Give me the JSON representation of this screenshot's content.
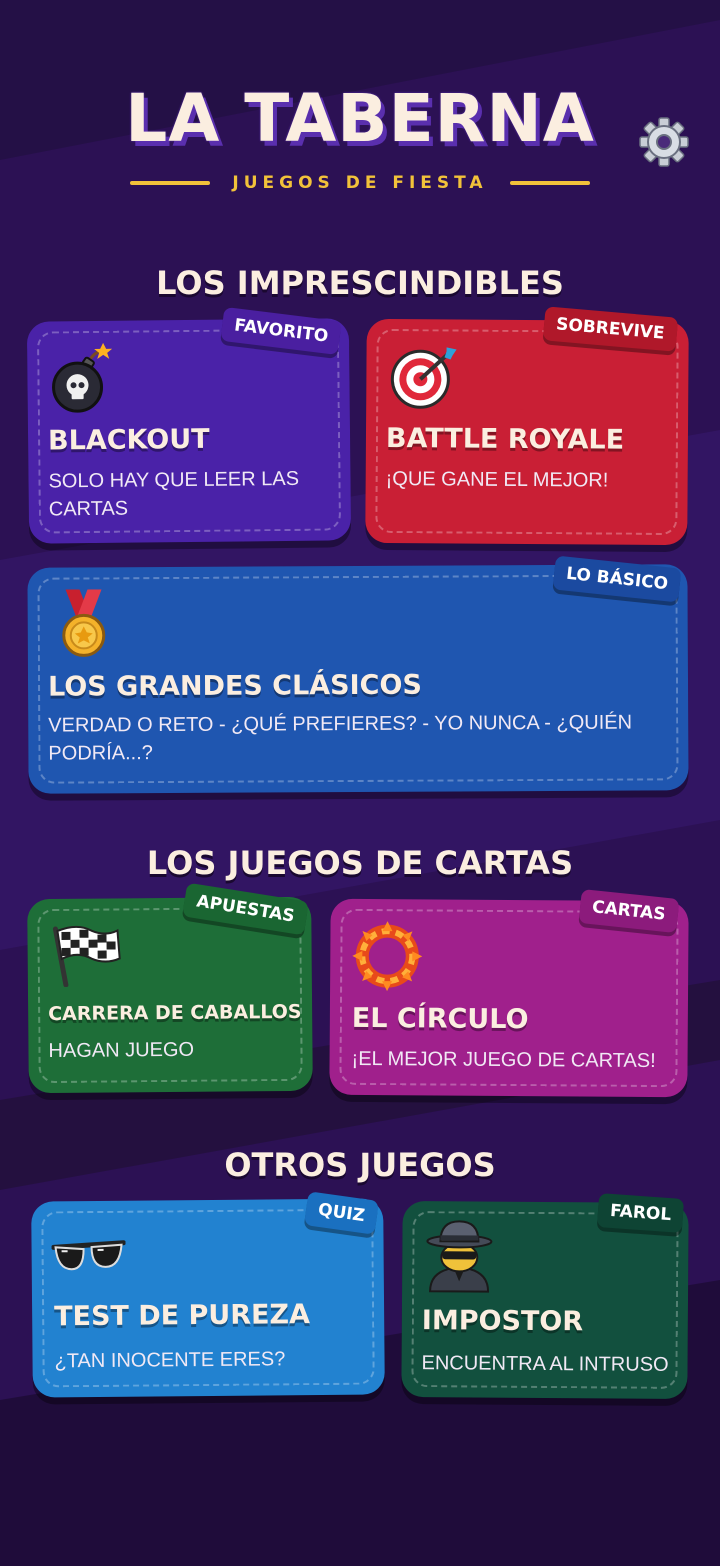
{
  "header": {
    "title": "LA TABERNA",
    "subtitle": "JUEGOS DE FIESTA",
    "settings_icon": "gear-icon"
  },
  "sections": [
    {
      "title": "LOS IMPRESCINDIBLES"
    },
    {
      "title": "LOS JUEGOS DE CARTAS"
    },
    {
      "title": "OTROS JUEGOS"
    }
  ],
  "cards": {
    "blackout": {
      "title": "BLACKOUT",
      "description": "SOLO HAY QUE LEER LAS CARTAS",
      "badge": "FAVORITO",
      "icon": "bomb-skull-icon",
      "color": "#4a22a8",
      "badge_color": "#4a1fa0"
    },
    "battle_royale": {
      "title": "BATTLE ROYALE",
      "description": "¡QUE GANE EL MEJOR!",
      "badge": "SOBREVIVE",
      "icon": "target-icon",
      "color": "#c91f35",
      "badge_color": "#b0182a"
    },
    "clasicos": {
      "title": "LOS GRANDES CLÁSICOS",
      "description": "VERDAD O RETO - ¿QUÉ PREFIERES? - YO NUNCA - ¿QUIÉN PODRÍA...?",
      "badge": "LO BÁSICO",
      "icon": "medal-icon",
      "color": "#1f56b0",
      "badge_color": "#1b4aa0"
    },
    "carrera": {
      "title": "CARRERA DE CABALLOS",
      "description": "HAGAN JUEGO",
      "badge": "APUESTAS",
      "icon": "checkered-flag-icon",
      "color": "#1e6e38",
      "badge_color": "#1a6632"
    },
    "circulo": {
      "title": "EL CÍRCULO",
      "description": "¡EL MEJOR JUEGO DE CARTAS!",
      "badge": "CARTAS",
      "icon": "fire-ring-icon",
      "color": "#a0208c",
      "badge_color": "#8c1b7c"
    },
    "pureza": {
      "title": "TEST DE PUREZA",
      "description": "¿TAN INOCENTE ERES?",
      "badge": "QUIZ",
      "icon": "sunglasses-icon",
      "color": "#2282d0",
      "badge_color": "#1a70c0"
    },
    "impostor": {
      "title": "IMPOSTOR",
      "description": "ENCUENTRA AL INTRUSO",
      "badge": "FAROL",
      "icon": "spy-icon",
      "color": "#12503e",
      "badge_color": "#0e4434"
    }
  }
}
